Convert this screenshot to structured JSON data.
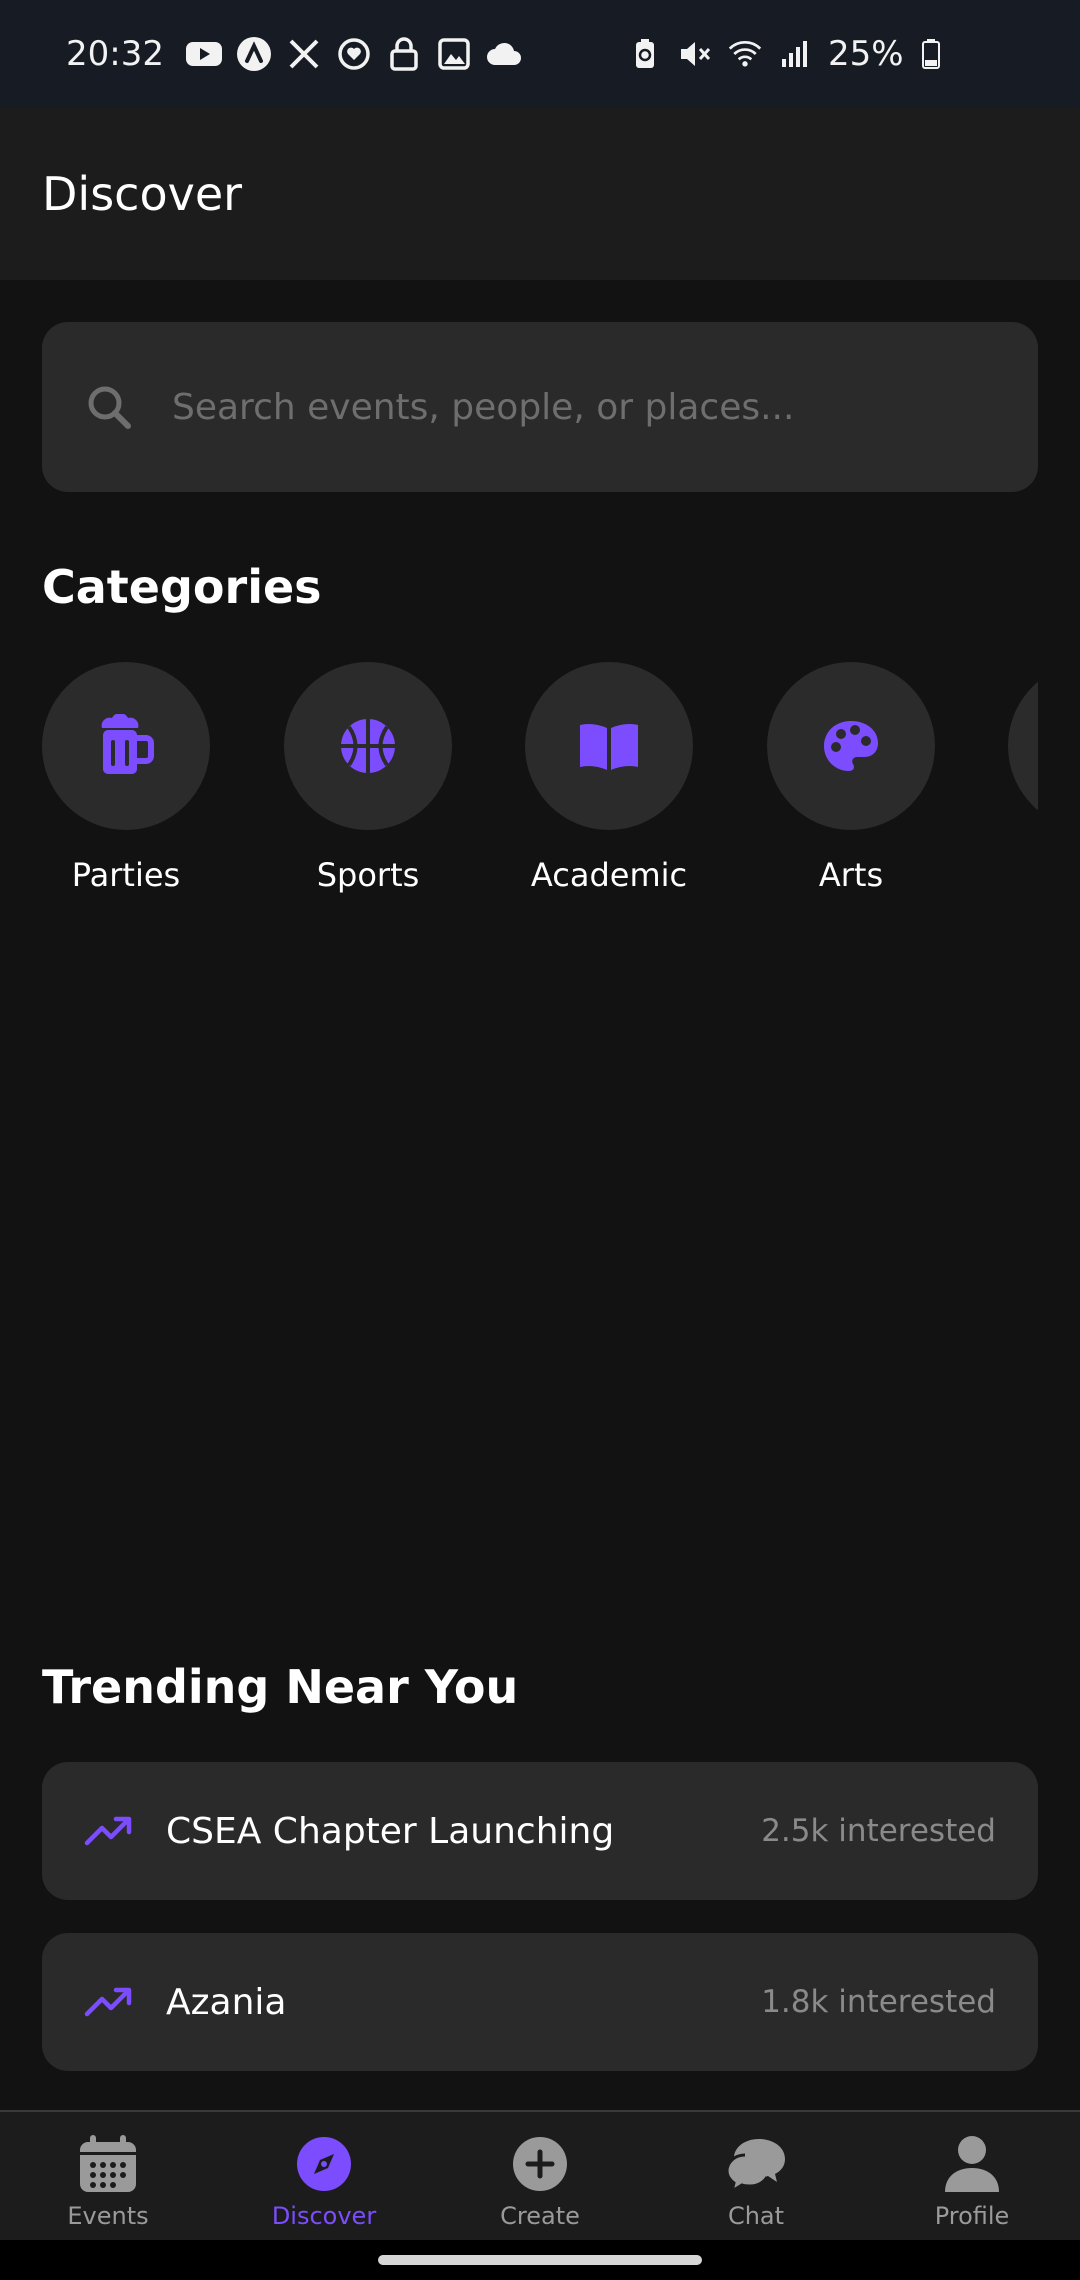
{
  "status_bar": {
    "time": "20:32",
    "battery": "25%"
  },
  "header": {
    "title": "Discover"
  },
  "search": {
    "placeholder": "Search events, people, or places..."
  },
  "categories": {
    "title": "Categories",
    "items": [
      {
        "label": "Parties",
        "icon": "beer-mug-icon"
      },
      {
        "label": "Sports",
        "icon": "basketball-icon"
      },
      {
        "label": "Academic",
        "icon": "book-icon"
      },
      {
        "label": "Arts",
        "icon": "palette-icon"
      }
    ]
  },
  "trending": {
    "title": "Trending Near You",
    "items": [
      {
        "name": "CSEA Chapter Launching",
        "count": "2.5k interested"
      },
      {
        "name": "Azania",
        "count": "1.8k interested"
      }
    ]
  },
  "bottom_nav": {
    "items": [
      {
        "label": "Events",
        "icon": "calendar-icon",
        "active": false
      },
      {
        "label": "Discover",
        "icon": "compass-icon",
        "active": true
      },
      {
        "label": "Create",
        "icon": "plus-circle-icon",
        "active": false
      },
      {
        "label": "Chat",
        "icon": "chat-icon",
        "active": false
      },
      {
        "label": "Profile",
        "icon": "user-icon",
        "active": false
      }
    ]
  },
  "colors": {
    "accent": "#7c4dff",
    "background": "#121212",
    "surface": "#2a2a2a",
    "header": "#1c1c1c"
  }
}
